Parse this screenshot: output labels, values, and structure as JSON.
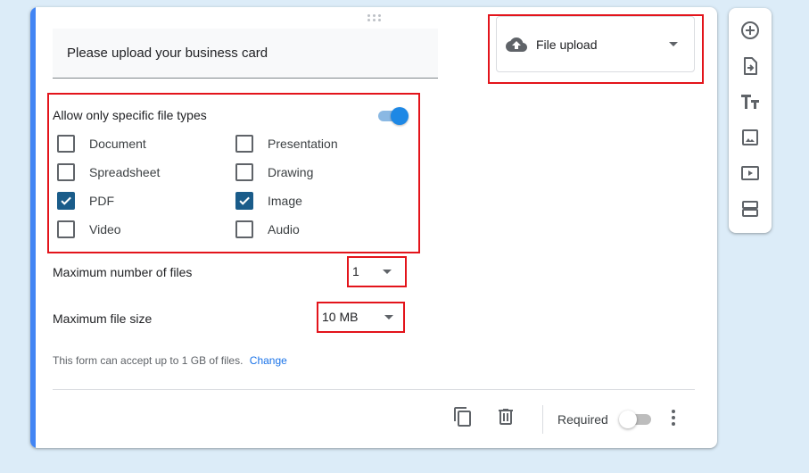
{
  "question": {
    "title": "Please upload your business card"
  },
  "question_type": {
    "label": "File upload",
    "icon": "cloud-upload-icon"
  },
  "file_types": {
    "title": "Allow only specific file types",
    "enabled": true,
    "options": [
      {
        "label": "Document",
        "checked": false
      },
      {
        "label": "Presentation",
        "checked": false
      },
      {
        "label": "Spreadsheet",
        "checked": false
      },
      {
        "label": "Drawing",
        "checked": false
      },
      {
        "label": "PDF",
        "checked": true
      },
      {
        "label": "Image",
        "checked": true
      },
      {
        "label": "Video",
        "checked": false
      },
      {
        "label": "Audio",
        "checked": false
      }
    ]
  },
  "max_files": {
    "label": "Maximum number of files",
    "value": "1"
  },
  "max_size": {
    "label": "Maximum file size",
    "value": "10 MB"
  },
  "info": {
    "text": "This form can accept up to 1 GB of files.",
    "link": "Change"
  },
  "footer": {
    "required_label": "Required",
    "required": false
  },
  "toolbar": {
    "items": [
      "add-question-icon",
      "import-questions-icon",
      "add-title-icon",
      "add-image-icon",
      "add-video-icon",
      "add-section-icon"
    ]
  },
  "colors": {
    "accent": "#4285f4",
    "checkbox_checked": "#1a5c8a",
    "toggle_on": "#1e88e5",
    "highlight": "#e3141b",
    "link": "#1a73e8"
  }
}
